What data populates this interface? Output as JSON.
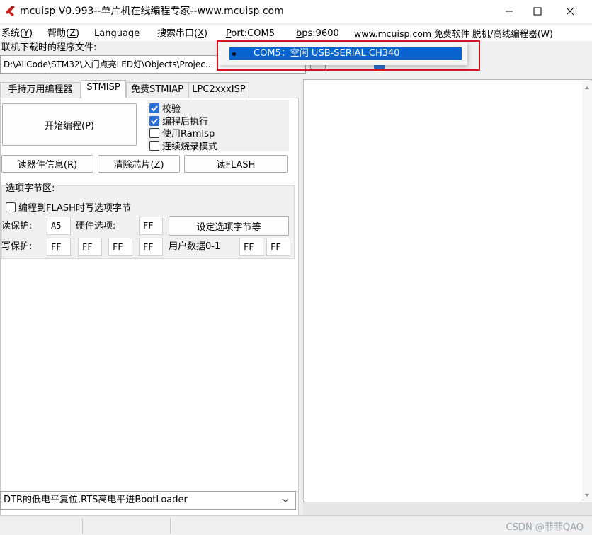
{
  "window": {
    "title": "mcuisp V0.993--单片机在线编程专家--www.mcuisp.com"
  },
  "menu": {
    "items": [
      {
        "label": "系统(",
        "key": "Y",
        "suffix": ")"
      },
      {
        "label": "帮助(",
        "key": "Z",
        "suffix": ")"
      },
      {
        "label": "Language",
        "key": "",
        "suffix": ""
      },
      {
        "label": "搜索串口(",
        "key": "X",
        "suffix": ")"
      },
      {
        "label": "",
        "key": "P",
        "suffix": "ort:COM5"
      },
      {
        "label": "",
        "key": "b",
        "suffix": "ps:9600"
      },
      {
        "label": "www.mcuisp.com 免费软件 脱机/高线编程器(",
        "key": "W",
        "suffix": ")"
      }
    ]
  },
  "port_dropdown": {
    "option": "COM5：空闲 USB-SERIAL CH340"
  },
  "file": {
    "label": "联机下载时的程序文件:",
    "path": "D:\\AllCode\\STM32\\入门点亮LED灯\\Objects\\Projec..."
  },
  "tabs": [
    {
      "label": "手持万用编程器"
    },
    {
      "label": "STMISP"
    },
    {
      "label": "免费STMIAP"
    },
    {
      "label": "LPC2xxxISP"
    }
  ],
  "stmisp": {
    "start_button": "开始编程(P)",
    "options": [
      {
        "label": "校验",
        "checked": true
      },
      {
        "label": "编程后执行",
        "checked": true
      },
      {
        "label": "使用RamIsp",
        "checked": false
      },
      {
        "label": "连续烧录模式",
        "checked": false
      }
    ],
    "read_info_button": "读器件信息(R)",
    "erase_button": "清除芯片(Z)",
    "read_flash_button": "读FLASH",
    "option_bytes": {
      "section_label": "选项字节区:",
      "write_on_flash_label": "编程到FLASH时写选项字节",
      "read_protect_label": "读保护:",
      "read_protect_value": "A5",
      "hw_option_label": "硬件选项:",
      "hw_option_value": "FF",
      "set_button": "设定选项字节等",
      "write_protect_label": "写保护:",
      "write_protect_values": [
        "FF",
        "FF",
        "FF",
        "FF"
      ],
      "user_data_label": "用户数据0-1",
      "user_data_values": [
        "FF",
        "FF"
      ]
    },
    "bootloader_mode": "DTR的低电平复位,RTS高电平进BootLoader"
  },
  "statusbar": {
    "watermark": "CSDN @菲菲QAQ"
  },
  "colors": {
    "accent": "#0a64d0",
    "checkbox": "#2a6fd6",
    "highlight_box": "#d9121e"
  }
}
